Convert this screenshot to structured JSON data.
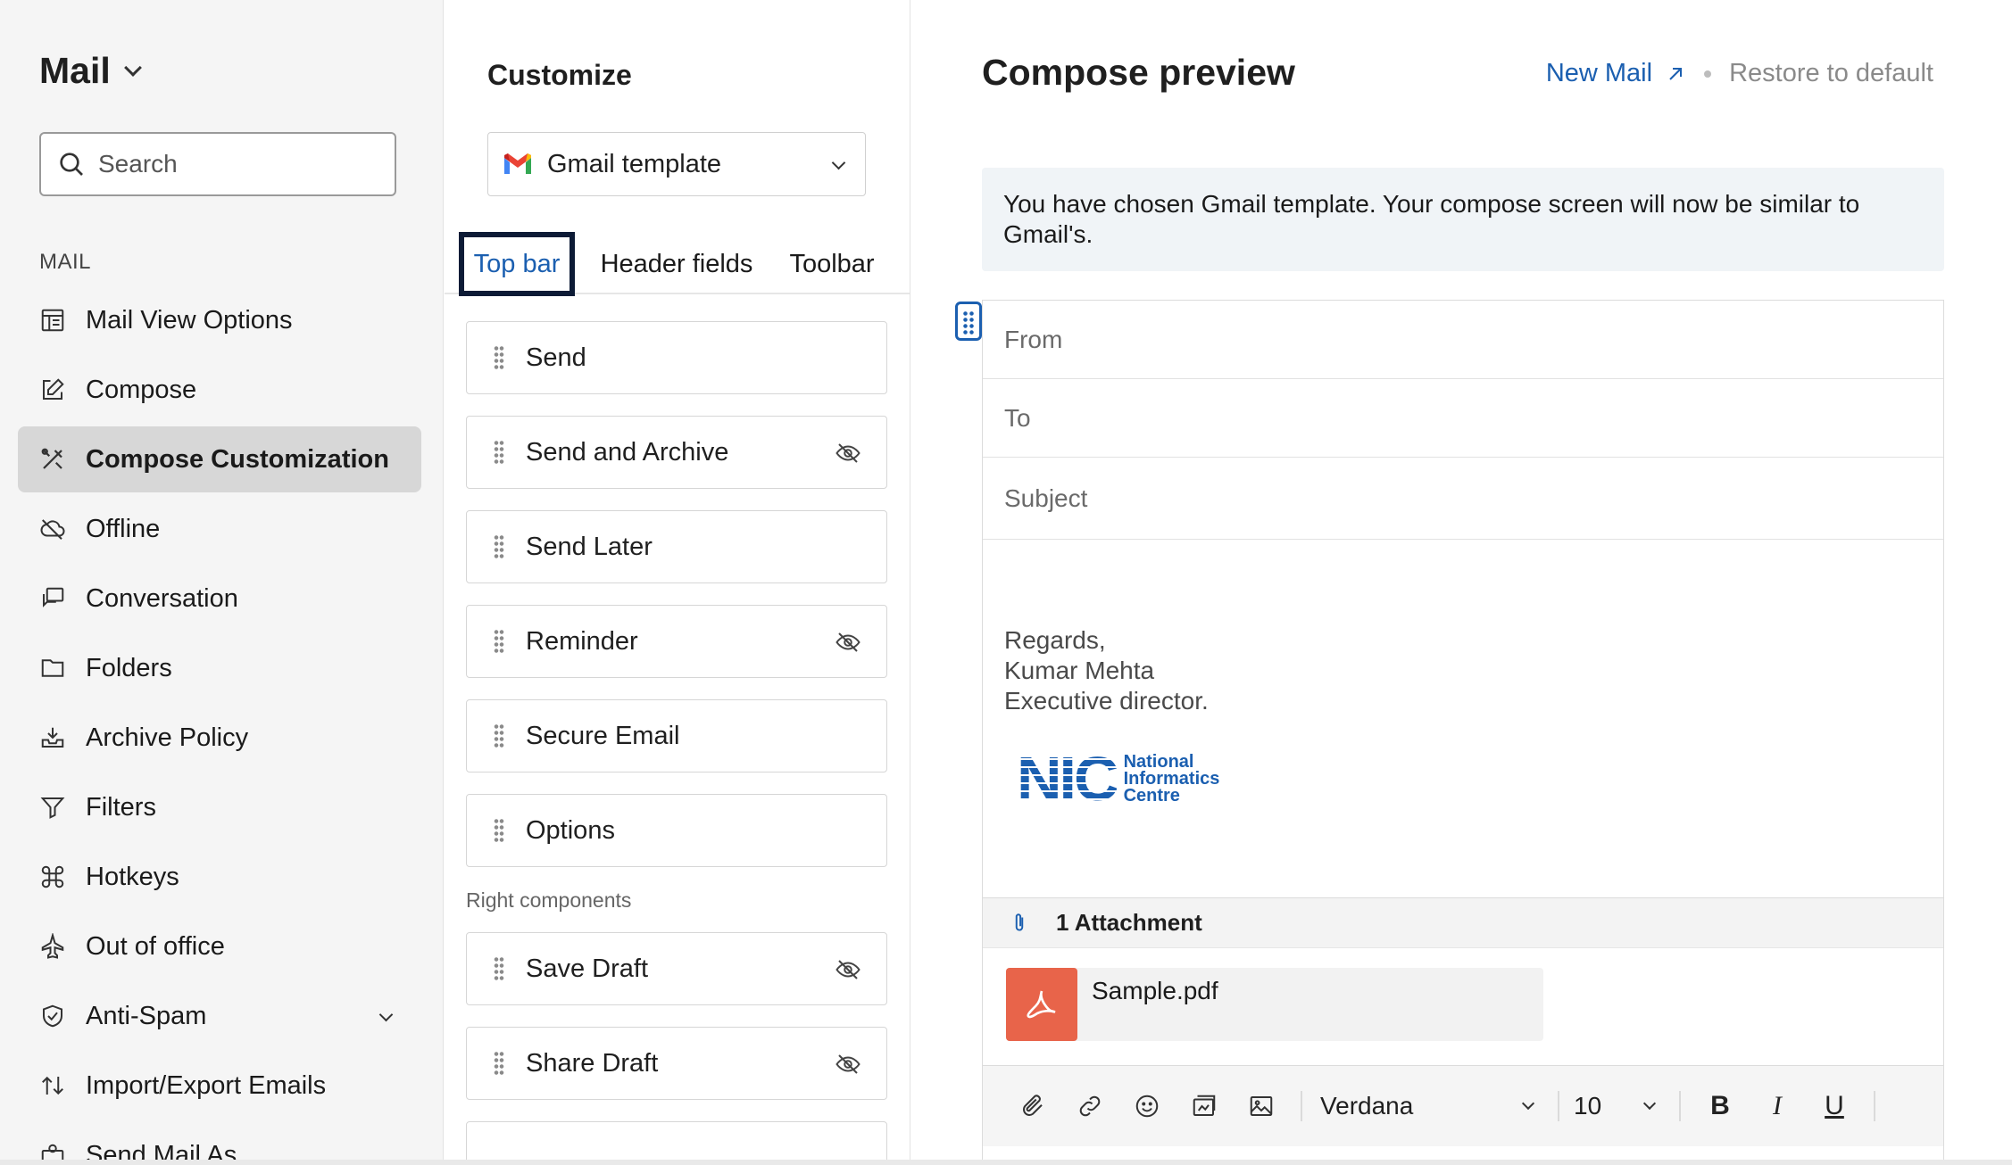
{
  "sidebar": {
    "app_title": "Mail",
    "search_placeholder": "Search",
    "section_label": "MAIL",
    "items": [
      {
        "label": "Mail View Options",
        "icon": "layout-icon"
      },
      {
        "label": "Compose",
        "icon": "edit-icon"
      },
      {
        "label": "Compose Customization",
        "icon": "tools-icon",
        "active": true
      },
      {
        "label": "Offline",
        "icon": "cloud-off-icon"
      },
      {
        "label": "Conversation",
        "icon": "chat-icon"
      },
      {
        "label": "Folders",
        "icon": "folder-icon"
      },
      {
        "label": "Archive Policy",
        "icon": "archive-icon"
      },
      {
        "label": "Filters",
        "icon": "filter-icon"
      },
      {
        "label": "Hotkeys",
        "icon": "command-icon"
      },
      {
        "label": "Out of office",
        "icon": "plane-icon"
      },
      {
        "label": "Anti-Spam",
        "icon": "shield-icon"
      },
      {
        "label": "Import/Export Emails",
        "icon": "import-export-icon"
      },
      {
        "label": "Send Mail As",
        "icon": "send-as-icon"
      }
    ]
  },
  "customize": {
    "title": "Customize",
    "template": "Gmail template",
    "tabs": [
      "Top bar",
      "Header fields",
      "Toolbar"
    ],
    "left_items": [
      {
        "label": "Send",
        "hidden": false
      },
      {
        "label": "Send and Archive",
        "hidden": true
      },
      {
        "label": "Send Later",
        "hidden": false
      },
      {
        "label": "Reminder",
        "hidden": true
      },
      {
        "label": "Secure Email",
        "hidden": false
      },
      {
        "label": "Options",
        "hidden": false
      }
    ],
    "right_label": "Right components",
    "right_items": [
      {
        "label": "Save Draft",
        "hidden": true
      },
      {
        "label": "Share Draft",
        "hidden": true
      }
    ]
  },
  "preview": {
    "title": "Compose preview",
    "new_mail": "New Mail",
    "restore": "Restore to default",
    "info": "You have chosen Gmail template. Your compose screen will now be similar to Gmail's.",
    "fields": {
      "from": "From",
      "to": "To",
      "subject": "Subject"
    },
    "signature": {
      "line1": "Regards,",
      "line2": "Kumar Mehta",
      "line3": "Executive director."
    },
    "logo": {
      "mark": "NIC",
      "line1": "National",
      "line2": "Informatics",
      "line3": "Centre"
    },
    "attachment_count": "1 Attachment",
    "attachment_file": "Sample.pdf",
    "font": "Verdana",
    "font_size": "10",
    "format": {
      "bold": "B",
      "italic": "I",
      "underline": "U"
    }
  },
  "colors": {
    "accent": "#1b5fb0",
    "pdf": "#e8644a",
    "active_bg": "#d7d7d7"
  }
}
